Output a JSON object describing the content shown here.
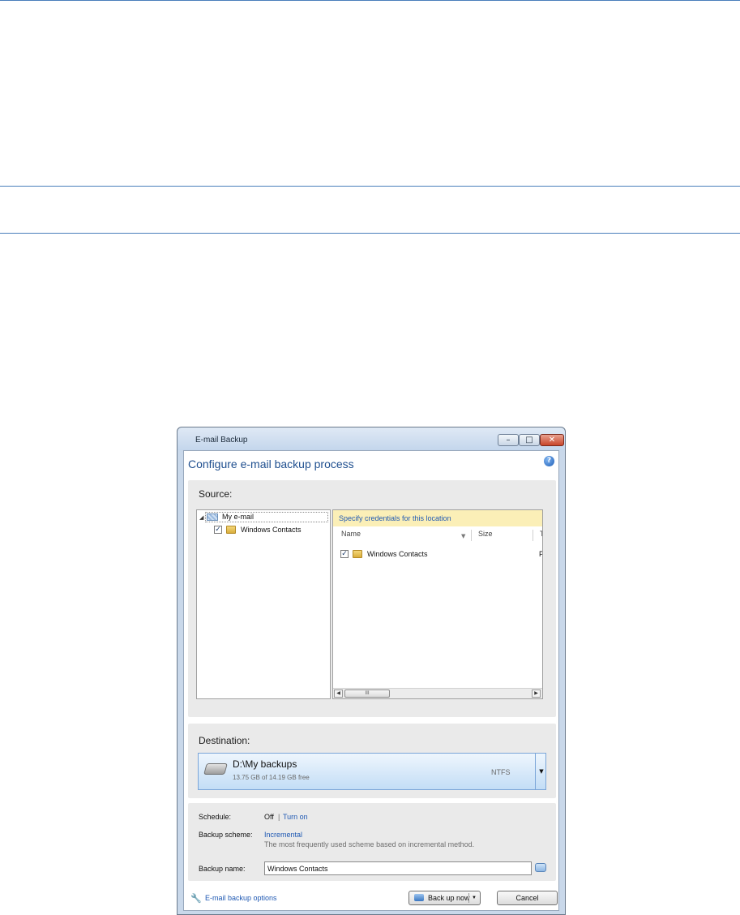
{
  "window": {
    "title": "E-mail Backup",
    "heading": "Configure e-mail backup process",
    "controls": {
      "minimize": "–",
      "maximize": "□",
      "close": "✕"
    },
    "help_icon": "help-icon"
  },
  "source": {
    "label": "Source:",
    "tree": {
      "root_label": "My e-mail",
      "child_label": "Windows Contacts",
      "child_checked": "✓"
    },
    "list": {
      "credentials_bar": "Specify credentials for this location",
      "columns": [
        "Name",
        "Size",
        "T"
      ],
      "rows": [
        {
          "name": "Windows Contacts",
          "checked": "✓",
          "truncated": "P"
        }
      ],
      "scrollbar": {
        "left": "◀",
        "right": "▶",
        "thumb": "III"
      }
    }
  },
  "destination": {
    "label": "Destination:",
    "path": "D:\\My backups",
    "free_space": "13.75 GB of 14.19 GB free",
    "filesystem": "NTFS",
    "dropdown": "▼"
  },
  "options": {
    "schedule": {
      "label": "Schedule:",
      "value": "Off",
      "separator": "|",
      "action": "Turn on"
    },
    "scheme": {
      "label": "Backup scheme:",
      "value": "Incremental",
      "description": "The most frequently used scheme based on incremental method."
    },
    "backup_name": {
      "label": "Backup name:",
      "value": "Windows Contacts"
    }
  },
  "footer": {
    "options_link": "E-mail backup options",
    "backup_now": "Back up now",
    "backup_dropdown": "▼",
    "cancel": "Cancel"
  },
  "colors": {
    "accent": "#1f59b3",
    "heading": "#1f4f8f",
    "credentials_bg": "#fbefb7",
    "rules": "#4a7ebb"
  }
}
